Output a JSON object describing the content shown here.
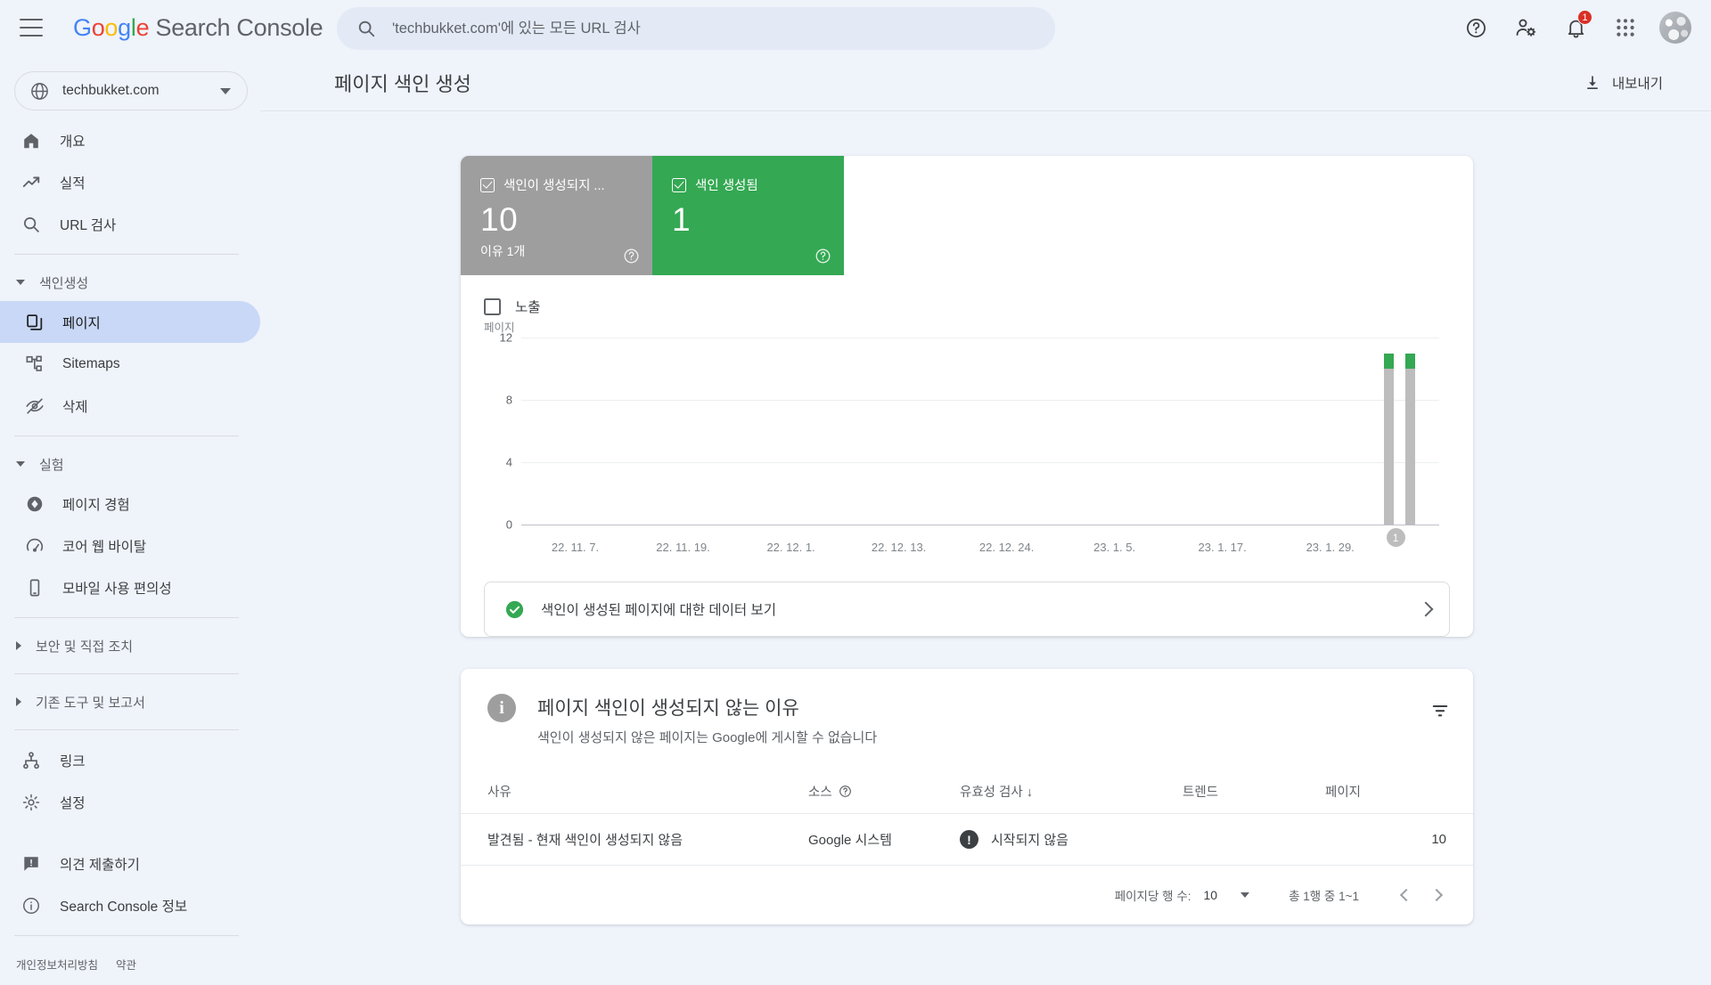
{
  "topbar": {
    "brand_google": "Google",
    "brand_suffix": "Search Console",
    "search_placeholder": "'techbukket.com'에 있는 모든 URL 검사",
    "search_value": "",
    "notification_count": "1"
  },
  "sidebar": {
    "property": "techbukket.com",
    "items": [
      {
        "label": "개요",
        "icon": "home-icon"
      },
      {
        "label": "실적",
        "icon": "trending-up-icon"
      },
      {
        "label": "URL 검사",
        "icon": "search-icon"
      }
    ],
    "group_indexing": {
      "label": "색인생성",
      "expanded": true,
      "items": [
        {
          "label": "페이지",
          "icon": "pages-icon",
          "active": true
        },
        {
          "label": "Sitemaps",
          "icon": "sitemap-icon",
          "active": false
        },
        {
          "label": "삭제",
          "icon": "eye-off-icon",
          "active": false
        }
      ]
    },
    "group_experience": {
      "label": "실험",
      "expanded": true,
      "items": [
        {
          "label": "페이지 경험",
          "icon": "page-experience-icon"
        },
        {
          "label": "코어 웹 바이탈",
          "icon": "speedometer-icon"
        },
        {
          "label": "모바일 사용 편의성",
          "icon": "mobile-icon"
        }
      ]
    },
    "group_security": {
      "label": "보안 및 직접 조치",
      "expanded": false
    },
    "group_legacy": {
      "label": "기존 도구 및 보고서",
      "expanded": false
    },
    "links_item": {
      "label": "링크",
      "icon": "links-icon"
    },
    "settings_item": {
      "label": "설정",
      "icon": "gear-icon"
    },
    "feedback_item": {
      "label": "의견 제출하기",
      "icon": "feedback-icon"
    },
    "about_item": {
      "label": "Search Console 정보",
      "icon": "info-icon"
    },
    "legal": {
      "privacy": "개인정보처리방침",
      "terms": "약관"
    }
  },
  "page": {
    "title": "페이지 색인 생성",
    "export_label": "내보내기"
  },
  "status_tiles": [
    {
      "label": "색인이 생성되지 ...",
      "value": "10",
      "sub": "이유 1개",
      "color": "#9e9e9e"
    },
    {
      "label": "색인 생성됨",
      "value": "1",
      "sub": "",
      "color": "#34a853"
    }
  ],
  "chart_legend": {
    "label": "노출",
    "checked": false
  },
  "chart_data": {
    "type": "bar",
    "title": "",
    "ylabel": "페이지",
    "xlabel": "",
    "ylim": [
      0,
      12
    ],
    "yticks": [
      0,
      4,
      8,
      12
    ],
    "grid": true,
    "legend_position": "top-left",
    "stacked": true,
    "categories": [
      "22. 11. 7.",
      "22. 11. 19.",
      "22. 12. 1.",
      "22. 12. 13.",
      "22. 12. 24.",
      "23. 1. 5.",
      "23. 1. 17.",
      "23. 1. 29."
    ],
    "series": [
      {
        "name": "색인이 생성되지 않음",
        "color": "#bdbdbd",
        "values": [
          0,
          0,
          0,
          0,
          0,
          0,
          0,
          10
        ]
      },
      {
        "name": "색인 생성됨",
        "color": "#34a853",
        "values": [
          0,
          0,
          0,
          0,
          0,
          0,
          0,
          1
        ]
      }
    ],
    "bars": [
      {
        "x_pct": 94.0,
        "not_indexed": 10,
        "indexed": 1
      },
      {
        "x_pct": 96.3,
        "not_indexed": 10,
        "indexed": 1
      }
    ],
    "annotations": [
      {
        "label": "1",
        "x_pct": 95.2
      }
    ]
  },
  "banner": {
    "text": "색인이 생성된 페이지에 대한 데이터 보기",
    "icon": "check-circle-icon"
  },
  "reasons": {
    "title": "페이지 색인이 생성되지 않는 이유",
    "subtitle": "색인이 생성되지 않은 페이지는 Google에 게시할 수 없습니다",
    "headers": {
      "reason": "사유",
      "source": "소스",
      "validation": "유효성 검사",
      "validation_sort": "↓",
      "trend": "트렌드",
      "pages": "페이지"
    },
    "rows": [
      {
        "reason": "발견됨 - 현재 색인이 생성되지 않음",
        "source": "Google 시스템",
        "validation": "시작되지 않음",
        "trend": "",
        "pages": "10"
      }
    ],
    "pager": {
      "rows_label": "페이지당 행 수:",
      "rows_value": "10",
      "range": "총 1행 중 1~1"
    }
  }
}
